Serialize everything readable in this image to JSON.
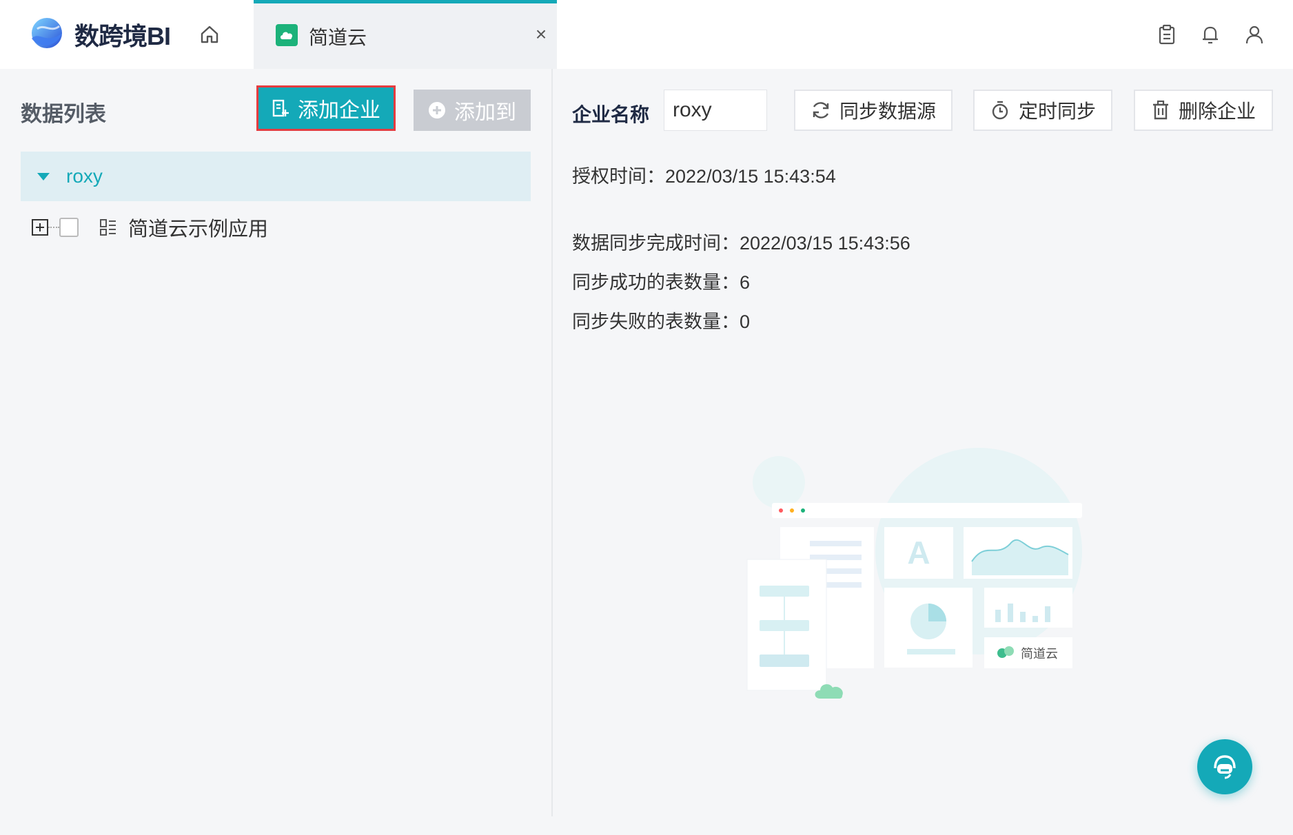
{
  "app": {
    "title": "数跨境BI"
  },
  "tab": {
    "label": "简道云",
    "close": "×"
  },
  "top_icons": [
    "clipboard-icon",
    "bell-icon",
    "user-icon"
  ],
  "left": {
    "title": "数据列表",
    "add_enterprise_label": "添加企业",
    "add_to_label": "添加到",
    "tree_root_label": "roxy",
    "tree_item_label": "简道云示例应用"
  },
  "right": {
    "enterprise_name_label": "企业名称",
    "enterprise_name_value": "roxy",
    "sync_source_label": "同步数据源",
    "scheduled_sync_label": "定时同步",
    "delete_enterprise_label": "删除企业",
    "auth_time": "授权时间：2022/03/15 15:43:54",
    "sync_done_time": "数据同步完成时间：2022/03/15 15:43:56",
    "sync_success_count": "同步成功的表数量：6",
    "sync_fail_count": "同步失败的表数量：0"
  },
  "illustration": {
    "badge_label": "简道云"
  },
  "colors": {
    "accent": "#14a9b8",
    "highlight_border": "#e53c40",
    "brand_green": "#1cb27a"
  }
}
